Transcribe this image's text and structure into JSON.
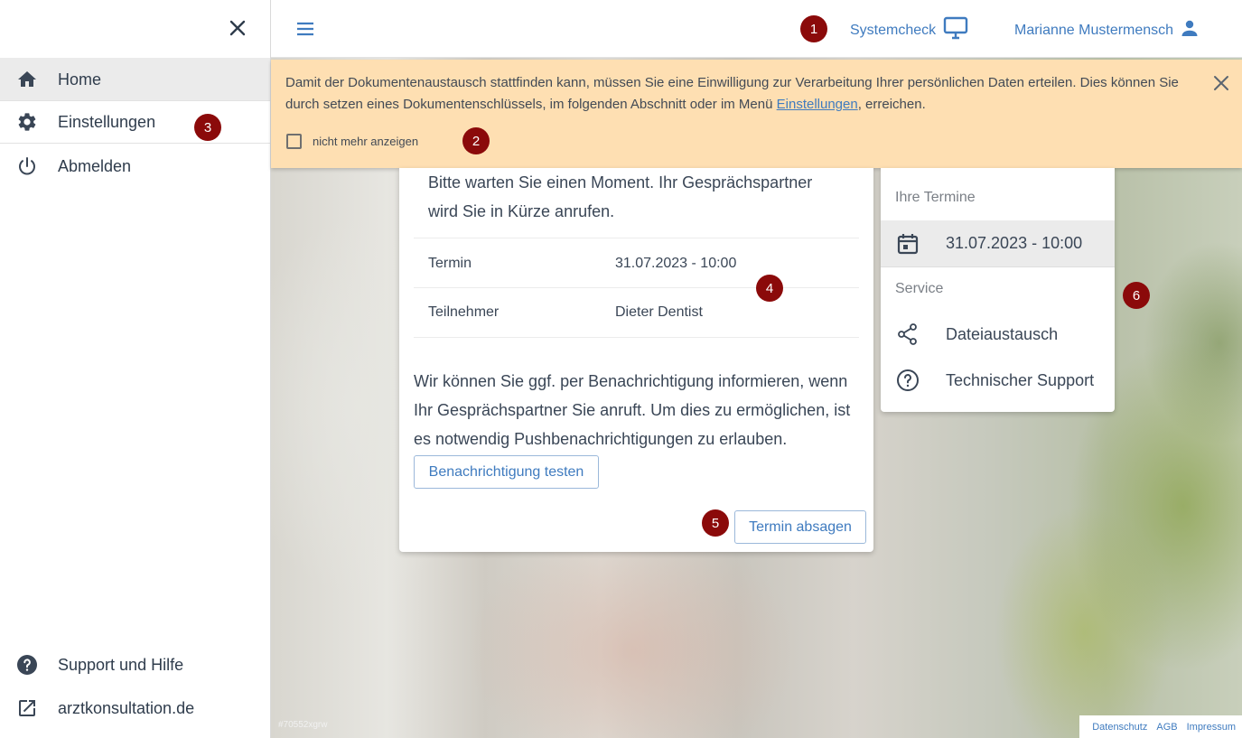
{
  "sidebar": {
    "items": [
      {
        "label": "Home",
        "icon": "home-icon"
      },
      {
        "label": "Einstellungen",
        "icon": "gear-icon"
      },
      {
        "label": "Abmelden",
        "icon": "power-icon"
      }
    ],
    "bottom_items": [
      {
        "label": "Support und Hilfe",
        "icon": "help-circle-icon"
      },
      {
        "label": "arztkonsultation.de",
        "icon": "external-link-icon"
      }
    ]
  },
  "topbar": {
    "systemcheck_label": "Systemcheck",
    "user_name": "Marianne Mustermensch"
  },
  "banner": {
    "text_before_link": "Damit der Dokumentenaustausch stattfinden kann, müssen Sie eine Einwilligung zur Verarbeitung Ihrer persönlichen Daten erteilen. Dies können Sie durch setzen eines Dokumentenschlüssels, im folgenden Abschnitt oder im Menü ",
    "link_text": "Einstellungen",
    "text_after_link": ", erreichen.",
    "checkbox_label": "nicht mehr anzeigen",
    "checkbox_checked": false
  },
  "card": {
    "wait_text": "Bitte warten Sie einen Moment. Ihr Gesprächspartner wird Sie in Kürze anrufen.",
    "details": [
      {
        "key": "Termin",
        "value": "31.07.2023 - 10:00"
      },
      {
        "key": "Teilnehmer",
        "value": "Dieter Dentist"
      }
    ],
    "notification_text": "Wir können Sie ggf. per Benachrichtigung informieren, wenn Ihr Gesprächspartner Sie anruft. Um dies zu ermöglichen, ist es notwendig Pushbenachrichtigungen zu erlauben.",
    "test_button": "Benachrichtigung testen",
    "cancel_button": "Termin absagen"
  },
  "side_panel": {
    "appointments_header": "Ihre Termine",
    "appointment": "31.07.2023 - 10:00",
    "service_header": "Service",
    "services": [
      {
        "label": "Dateiaustausch",
        "icon": "share-icon"
      },
      {
        "label": "Technischer Support",
        "icon": "help-outline-icon"
      }
    ]
  },
  "badges": [
    "1",
    "2",
    "3",
    "4",
    "5",
    "6"
  ],
  "background_tag": "#70552xgrw",
  "footer": {
    "links": [
      "Datenschutz",
      "AGB",
      "Impressum"
    ]
  },
  "colors": {
    "accent": "#3f7bbf",
    "banner_bg": "#fedfb2",
    "badge_bg": "#8b0a0a",
    "text": "#3a4656"
  }
}
